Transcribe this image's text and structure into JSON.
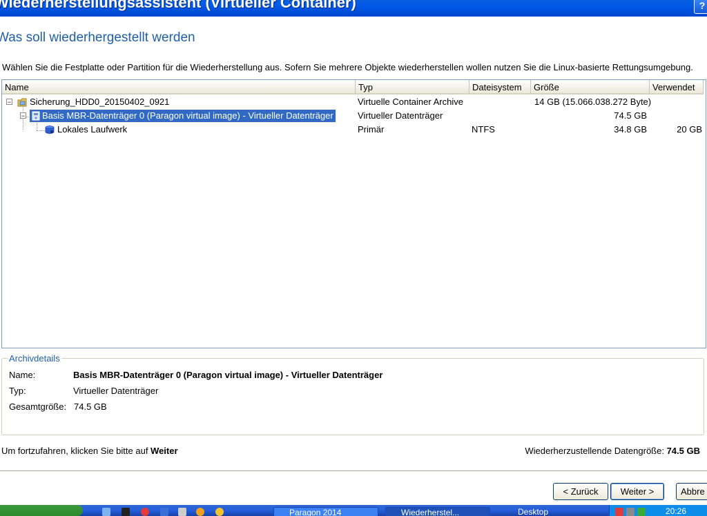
{
  "window": {
    "title": "Wiederherstellungsassistent (Virtueller Container)",
    "help_label": "?"
  },
  "heading": "Was soll wiederhergestellt werden",
  "instruction": "Wählen Sie die Festplatte oder Partition für die Wiederherstellung aus. Sofern Sie mehrere Objekte wiederherstellen wollen nutzen Sie die Linux-basierte Rettungsumgebung.",
  "tree": {
    "columns": [
      "Name",
      "Typ",
      "Dateisystem",
      "Größe",
      "Verwendet"
    ],
    "rows": [
      {
        "expander": "−",
        "name": "Sicherung_HDD0_20150402_0921",
        "type": "Virtuelle Container Archive",
        "filesystem": "",
        "size": "14 GB (15.066.038.272 Byte)",
        "used": ""
      },
      {
        "expander": "−",
        "name": "Basis MBR-Datenträger 0 (Paragon virtual image) - Virtueller Datenträger",
        "type": "Virtueller Datenträger",
        "filesystem": "",
        "size": "74.5 GB",
        "used": ""
      },
      {
        "expander": "",
        "name": "Lokales Laufwerk",
        "type": "Primär",
        "filesystem": "NTFS",
        "size": "34.8 GB",
        "used": "20 GB"
      }
    ]
  },
  "details": {
    "legend": "Archivdetails",
    "name_label": "Name:",
    "name_value": "Basis MBR-Datenträger 0 (Paragon virtual image) - Virtueller Datenträger",
    "type_label": "Typ:",
    "type_value": "Virtueller Datenträger",
    "total_label": "Gesamtgröße:",
    "total_value": "74.5 GB"
  },
  "footer": {
    "continue_prefix": "Um fortzufahren, klicken Sie bitte auf ",
    "continue_bold": "Weiter",
    "size_label": "Wiederherzustellende Datengröße: ",
    "size_value": "74.5 GB"
  },
  "buttons": {
    "back": "< Zurück",
    "next": "Weiter >",
    "cancel": "Abbre"
  },
  "taskbar": {
    "tasks": [
      "Paragon 2014",
      "Wiederherstel...",
      "Desktop"
    ],
    "clock": "20:26"
  },
  "colors": {
    "selection": "#316ac5",
    "heading": "#1f5fa8",
    "titlebar": "#0058e6"
  }
}
